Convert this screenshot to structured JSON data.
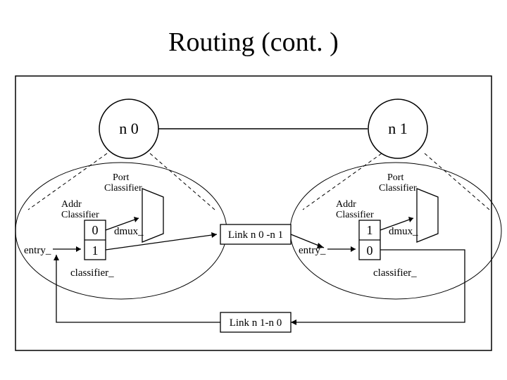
{
  "title": "Routing (cont. )",
  "nodes": {
    "left": {
      "name": "n 0",
      "port_label_l1": "Port",
      "port_label_l2": "Classifier",
      "addr_label_l1": "Addr",
      "addr_label_l2": "Classifier",
      "slot_top": "0",
      "slot_bot": "1",
      "dmux": "dmux_",
      "entry": "entry_",
      "classifier": "classifier_"
    },
    "right": {
      "name": "n 1",
      "port_label_l1": "Port",
      "port_label_l2": "Classifier",
      "addr_label_l1": "Addr",
      "addr_label_l2": "Classifier",
      "slot_top": "1",
      "slot_bot": "0",
      "dmux": "dmux_",
      "entry": "entry_",
      "classifier": "classifier_"
    }
  },
  "links": {
    "forward": "Link n 0 -n 1",
    "back": "Link n 1-n 0"
  }
}
